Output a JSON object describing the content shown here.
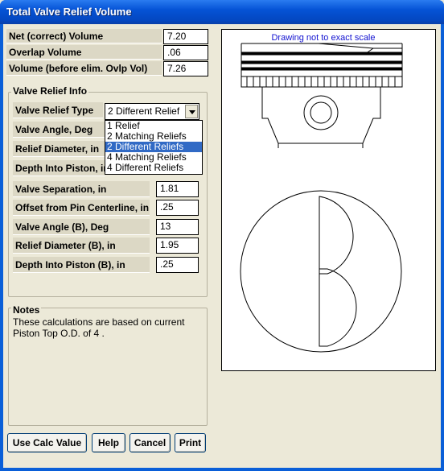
{
  "window": {
    "title": "Total Valve Relief Volume"
  },
  "summary": [
    {
      "label": "Net (correct) Volume",
      "value": "7.20"
    },
    {
      "label": "Overlap Volume",
      "value": ".06"
    },
    {
      "label": "Volume (before elim. Ovlp Vol)",
      "value": "7.26"
    }
  ],
  "valve_relief": {
    "group_title": "Valve Relief Info",
    "type_label": "Valve Relief Type",
    "type_value": "2 Different Relief",
    "type_options": [
      "1 Relief",
      "2 Matching Reliefs",
      "2 Different Reliefs",
      "4 Matching Reliefs",
      "4 Different Reliefs"
    ],
    "type_selected_index": 2,
    "hidden_rows": [
      {
        "label": "Valve Angle, Deg"
      },
      {
        "label": "Relief Diameter, in"
      },
      {
        "label": "Depth Into Piston, in"
      }
    ],
    "rows": [
      {
        "label": "Valve Separation, in",
        "value": "1.81"
      },
      {
        "label": "Offset from Pin Centerline, in",
        "value": ".25"
      },
      {
        "label": "Valve Angle (B), Deg",
        "value": "13"
      },
      {
        "label": "Relief Diameter (B), in",
        "value": "1.95"
      },
      {
        "label": "Depth Into Piston (B), in",
        "value": ".25"
      }
    ]
  },
  "notes": {
    "title": "Notes",
    "text": "These calculations are based on current Piston Top O.D. of  4 ."
  },
  "buttons": {
    "use_calc": "Use Calc Value",
    "help": "Help",
    "cancel": "Cancel",
    "print": "Print"
  },
  "drawing": {
    "caption": "Drawing not to exact scale",
    "caption_color": "#1010d0"
  }
}
